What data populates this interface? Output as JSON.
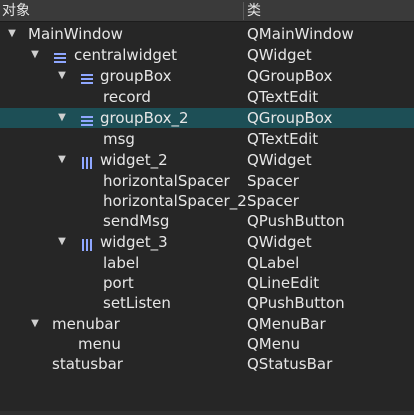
{
  "header": {
    "col_object": "对象",
    "col_class": "类"
  },
  "rows": [
    {
      "name": "MainWindow",
      "cls": "QMainWindow",
      "expander": "expanded",
      "layout_icon": "none"
    },
    {
      "name": "centralwidget",
      "cls": "QWidget",
      "expander": "expanded",
      "layout_icon": "vertical-layout-icon"
    },
    {
      "name": "groupBox",
      "cls": "QGroupBox",
      "expander": "expanded",
      "layout_icon": "vertical-layout-icon"
    },
    {
      "name": "record",
      "cls": "QTextEdit",
      "expander": "none",
      "layout_icon": "none"
    },
    {
      "name": "groupBox_2",
      "cls": "QGroupBox",
      "expander": "expanded",
      "layout_icon": "vertical-layout-icon",
      "selected": true
    },
    {
      "name": "msg",
      "cls": "QTextEdit",
      "expander": "none",
      "layout_icon": "none"
    },
    {
      "name": "widget_2",
      "cls": "QWidget",
      "expander": "expanded",
      "layout_icon": "horizontal-layout-icon"
    },
    {
      "name": "horizontalSpacer",
      "cls": "Spacer",
      "expander": "none",
      "layout_icon": "none"
    },
    {
      "name": "horizontalSpacer_2",
      "cls": "Spacer",
      "expander": "none",
      "layout_icon": "none"
    },
    {
      "name": "sendMsg",
      "cls": "QPushButton",
      "expander": "none",
      "layout_icon": "none"
    },
    {
      "name": "widget_3",
      "cls": "QWidget",
      "expander": "expanded",
      "layout_icon": "horizontal-layout-icon"
    },
    {
      "name": "label",
      "cls": "QLabel",
      "expander": "none",
      "layout_icon": "none"
    },
    {
      "name": "port",
      "cls": "QLineEdit",
      "expander": "none",
      "layout_icon": "none"
    },
    {
      "name": "setListen",
      "cls": "QPushButton",
      "expander": "none",
      "layout_icon": "none"
    },
    {
      "name": "menubar",
      "cls": "QMenuBar",
      "expander": "expanded",
      "layout_icon": "none"
    },
    {
      "name": "menu",
      "cls": "QMenu",
      "expander": "none",
      "layout_icon": "none"
    },
    {
      "name": "statusbar",
      "cls": "QStatusBar",
      "expander": "none",
      "layout_icon": "none"
    }
  ],
  "colors": {
    "background": "#262626",
    "header": "#3a3a3a",
    "selection": "#1d4f56",
    "icon": "#8fa7ff"
  }
}
